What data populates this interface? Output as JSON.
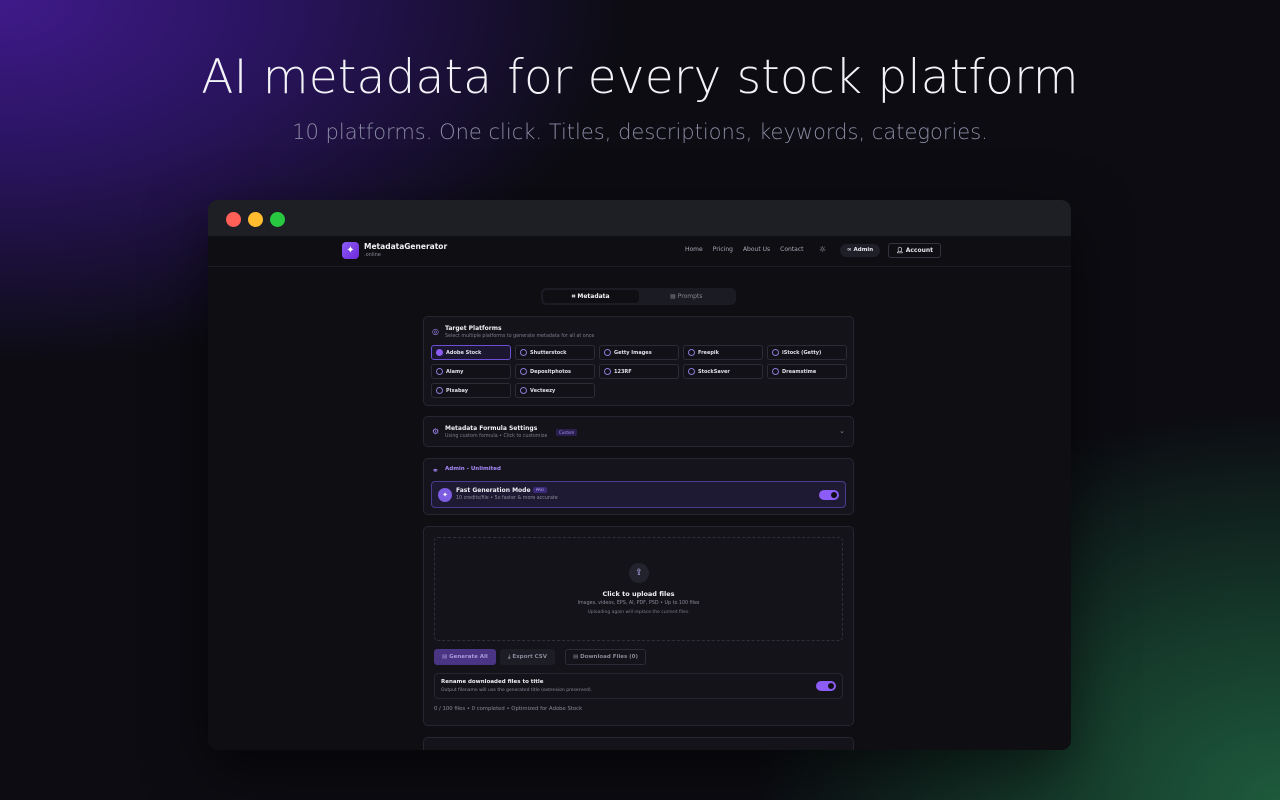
{
  "hero": {
    "title": "AI metadata for every stock platform",
    "subtitle": "10 platforms. One click. Titles, descriptions, keywords, categories."
  },
  "nav": {
    "brand_name": "MetadataGenerator",
    "brand_suffix": ".online",
    "links": [
      "Home",
      "Pricing",
      "About Us",
      "Contact"
    ],
    "admin_label": "∞ Admin",
    "account_label": "Account"
  },
  "tabs": [
    {
      "label": "Metadata",
      "active": true
    },
    {
      "label": "Prompts",
      "active": false
    }
  ],
  "platforms": {
    "title": "Target Platforms",
    "description": "Select multiple platforms to generate metadata for all at once",
    "items": [
      {
        "label": "Adobe Stock",
        "selected": true
      },
      {
        "label": "Shutterstock",
        "selected": false
      },
      {
        "label": "Getty Images",
        "selected": false
      },
      {
        "label": "Freepik",
        "selected": false
      },
      {
        "label": "iStock (Getty)",
        "selected": false
      },
      {
        "label": "Alamy",
        "selected": false
      },
      {
        "label": "Depositphotos",
        "selected": false
      },
      {
        "label": "123RF",
        "selected": false
      },
      {
        "label": "StockSaver",
        "selected": false
      },
      {
        "label": "Dreamstime",
        "selected": false
      },
      {
        "label": "Pixabay",
        "selected": false
      },
      {
        "label": "Vecteezy",
        "selected": false
      }
    ]
  },
  "formula": {
    "title": "Metadata Formula Settings",
    "description": "Using custom formula • Click to customize",
    "badge": "Custom"
  },
  "admin": {
    "label": "Admin - Unlimited",
    "fast_mode": {
      "title": "Fast Generation Mode",
      "badge": "PRO",
      "description": "10 credits/file • 5x faster & more accurate",
      "enabled": true
    }
  },
  "upload": {
    "title": "Click to upload files",
    "types": "Images, videos, EPS, AI, PDF, PSD • Up to 100 files",
    "note": "Uploading again will replace the current files."
  },
  "actions": {
    "generate_label": "Generate All",
    "export_label": "Export CSV",
    "download_label": "Download Files (0)"
  },
  "rename": {
    "title": "Rename downloaded files to title",
    "description": "Output filename will use the generated title (extension preserved).",
    "enabled": true
  },
  "status": "0 / 100 files • 0 completed • Optimized for Adobe Stock",
  "colors": {
    "accent": "#8b5cf6",
    "window_bg": "#0e0e13"
  }
}
